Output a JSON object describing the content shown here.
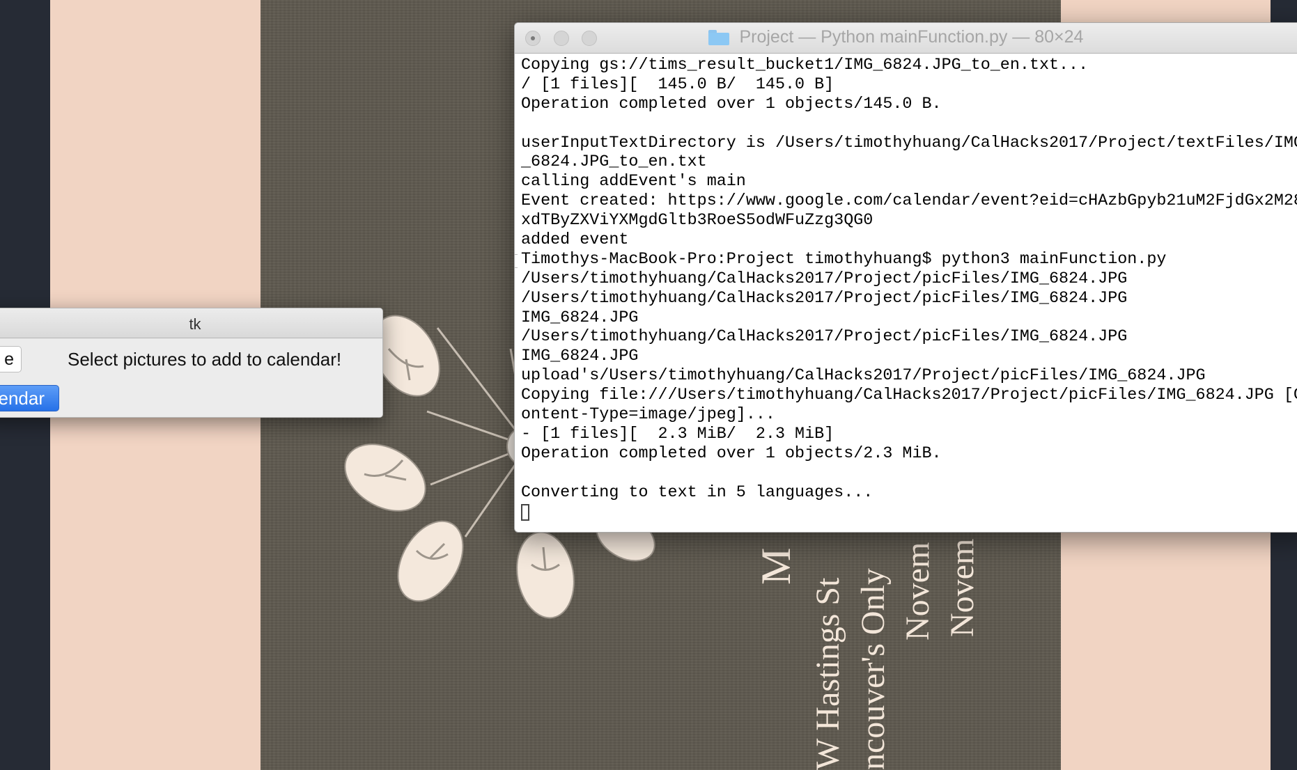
{
  "poster": {
    "lines": [
      "M",
      "W Hastings St",
      "ncouver's Only",
      "Novem",
      "Novem"
    ]
  },
  "tk_window": {
    "title": "tk",
    "choose_button_label": "e",
    "prompt_label": "Select pictures to add to calendar!",
    "add_button_label": "endar"
  },
  "terminal": {
    "title": "Project — Python mainFunction.py — 80×24",
    "lines": [
      "Copying gs://tims_result_bucket1/IMG_6824.JPG_to_en.txt...",
      "/ [1 files][  145.0 B/  145.0 B]",
      "Operation completed over 1 objects/145.0 B.",
      "",
      "userInputTextDirectory is /Users/timothyhuang/CalHacks2017/Project/textFiles/IMG",
      "_6824.JPG_to_en.txt",
      "calling addEvent's main",
      "Event created: https://www.google.com/calendar/event?eid=cHAzbGpyb21uM2FjdGx2M28",
      "xdTByZXViYXMgdGltb3RoeS5odWFuZzg3QG0",
      "added event",
      "Timothys-MacBook-Pro:Project timothyhuang$ python3 mainFunction.py",
      "/Users/timothyhuang/CalHacks2017/Project/picFiles/IMG_6824.JPG",
      "/Users/timothyhuang/CalHacks2017/Project/picFiles/IMG_6824.JPG",
      "IMG_6824.JPG",
      "/Users/timothyhuang/CalHacks2017/Project/picFiles/IMG_6824.JPG",
      "IMG_6824.JPG",
      "upload's/Users/timothyhuang/CalHacks2017/Project/picFiles/IMG_6824.JPG",
      "Copying file:///Users/timothyhuang/CalHacks2017/Project/picFiles/IMG_6824.JPG [C",
      "ontent-Type=image/jpeg]...",
      "- [1 files][  2.3 MiB/  2.3 MiB]",
      "Operation completed over 1 objects/2.3 MiB.",
      "",
      "Converting to text in 5 languages..."
    ]
  }
}
